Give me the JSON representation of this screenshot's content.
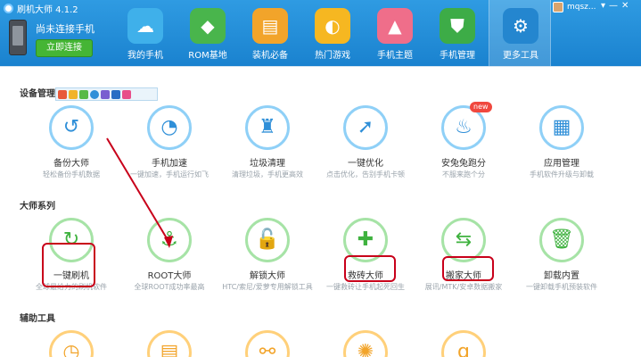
{
  "window": {
    "title": "刷机大师 4.1.2",
    "user_name": "mqsz...",
    "controls": [
      "▾",
      "—",
      "✕"
    ]
  },
  "device": {
    "status": "尚未连接手机",
    "connect_label": "立即连接"
  },
  "nav": [
    {
      "label": "我的手机",
      "icon": "cloud-icon",
      "glyph": "☁",
      "color": "#3fb0ea"
    },
    {
      "label": "ROM基地",
      "icon": "android-bag-icon",
      "glyph": "◆",
      "color": "#49b54c"
    },
    {
      "label": "装机必备",
      "icon": "stacked-layers-icon",
      "glyph": "▤",
      "color": "#f2a42a"
    },
    {
      "label": "热门游戏",
      "icon": "gamepad-icon",
      "glyph": "◐",
      "color": "#f6b721"
    },
    {
      "label": "手机主题",
      "icon": "shirt-icon",
      "glyph": "▲",
      "color": "#ef6e8a"
    },
    {
      "label": "手机管理",
      "icon": "shield-icon",
      "glyph": "⛊",
      "color": "#3dac47"
    },
    {
      "label": "更多工具",
      "icon": "gear-icon",
      "glyph": "⚙",
      "color": "#2486cf"
    }
  ],
  "sections": {
    "device_management": "设备管理",
    "master_series": "大师系列",
    "auxiliary_tools": "辅助工具"
  },
  "device_tools": [
    {
      "name": "备份大师",
      "desc": "轻松备份手机数据",
      "icon": "backup-icon",
      "glyph": "↺"
    },
    {
      "name": "手机加速",
      "desc": "一键加速，手机运行如飞",
      "icon": "speed-gauge-icon",
      "glyph": "◔"
    },
    {
      "name": "垃圾清理",
      "desc": "清理垃圾，手机更高效",
      "icon": "broom-icon",
      "glyph": "♜"
    },
    {
      "name": "一键优化",
      "desc": "点击优化，告别手机卡顿",
      "icon": "rocket-icon",
      "glyph": "➚"
    },
    {
      "name": "安兔兔跑分",
      "desc": "不服来跑个分",
      "icon": "flame-icon",
      "glyph": "♨",
      "badge": "new"
    },
    {
      "name": "应用管理",
      "desc": "手机软件升级与卸载",
      "icon": "app-grid-icon",
      "glyph": "▦"
    }
  ],
  "master_tools": [
    {
      "name": "一键刷机",
      "desc": "全球最给力的刷机软件",
      "icon": "refresh-icon",
      "glyph": "↻"
    },
    {
      "name": "ROOT大师",
      "desc": "全球ROOT成功率最高",
      "icon": "anchor-icon",
      "glyph": "⚓"
    },
    {
      "name": "解锁大师",
      "desc": "HTC/索尼/爱萝专用解锁工具",
      "icon": "unlock-icon",
      "glyph": "🔓"
    },
    {
      "name": "救砖大师",
      "desc": "一键救砖让手机起死回生",
      "icon": "phone-plus-icon",
      "glyph": "✚"
    },
    {
      "name": "搬家大师",
      "desc": "展讯/MTK/安卓数据搬家",
      "icon": "transfer-icon",
      "glyph": "⇆"
    },
    {
      "name": "卸载内置",
      "desc": "一键卸载手机预装软件",
      "icon": "trash-icon",
      "glyph": "🗑"
    }
  ],
  "aux_tools": [
    {
      "icon": "clock-icon",
      "glyph": "◷"
    },
    {
      "icon": "document-icon",
      "glyph": "▤"
    },
    {
      "icon": "share-icon",
      "glyph": "⚯"
    },
    {
      "icon": "sun-icon",
      "glyph": "✺"
    },
    {
      "icon": "g-letter-icon",
      "glyph": "g"
    }
  ]
}
